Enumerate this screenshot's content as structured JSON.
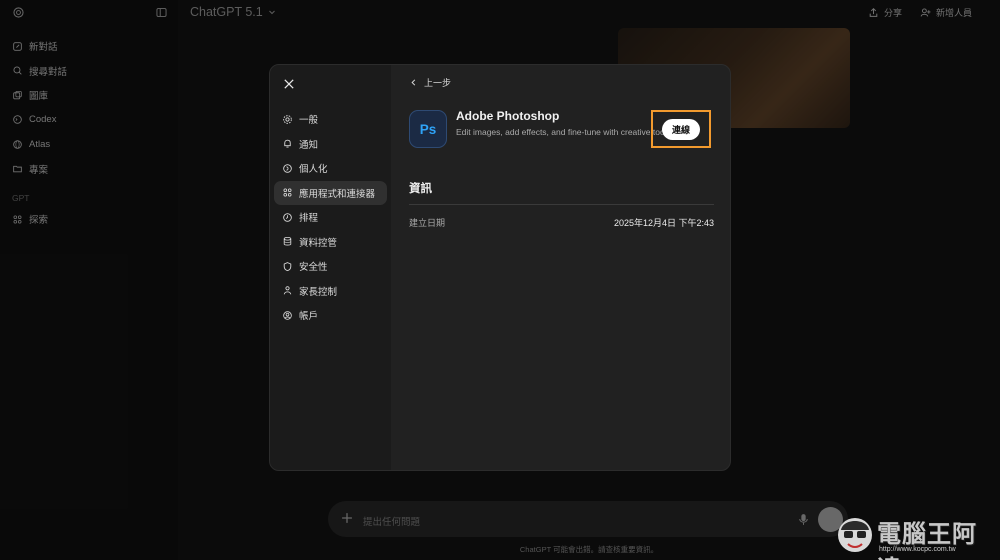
{
  "sidebar": {
    "items": [
      {
        "label": "新對話",
        "icon": "edit-icon"
      },
      {
        "label": "搜尋對話",
        "icon": "search-icon"
      },
      {
        "label": "圖庫",
        "icon": "images-icon"
      },
      {
        "label": "Codex",
        "icon": "codex-icon"
      },
      {
        "label": "Atlas",
        "icon": "globe-icon"
      },
      {
        "label": "專案",
        "icon": "folder-icon"
      }
    ],
    "section_label": "GPT",
    "explore_label": "探索"
  },
  "header": {
    "model_name": "ChatGPT 5.1",
    "share_label": "分享",
    "add_people_label": "新增人員"
  },
  "modal": {
    "nav": [
      {
        "label": "一般",
        "icon": "gear-icon"
      },
      {
        "label": "通知",
        "icon": "bell-icon"
      },
      {
        "label": "個人化",
        "icon": "personalize-icon"
      },
      {
        "label": "應用程式和連接器",
        "icon": "apps-icon",
        "active": true
      },
      {
        "label": "排程",
        "icon": "clock-icon"
      },
      {
        "label": "資料控管",
        "icon": "database-icon"
      },
      {
        "label": "安全性",
        "icon": "shield-icon"
      },
      {
        "label": "家長控制",
        "icon": "parent-icon"
      },
      {
        "label": "帳戶",
        "icon": "account-icon"
      }
    ],
    "back_label": "上一步",
    "app": {
      "icon_text": "Ps",
      "name": "Adobe Photoshop",
      "description": "Edit images, add effects, and fine-tune with creative tools",
      "connect_label": "連線"
    },
    "section_title": "資訊",
    "info": {
      "label": "建立日期",
      "value": "2025年12月4日 下午2:43"
    }
  },
  "composer": {
    "placeholder": "提出任何問題"
  },
  "disclaimer": "ChatGPT 可能會出錯。請查核重要資訊。",
  "watermark": {
    "text": "電腦王阿達",
    "url": "http://www.kocpc.com.tw"
  },
  "colors": {
    "highlight": "#f29a2e",
    "photoshop_blue": "#2fa3f7"
  }
}
